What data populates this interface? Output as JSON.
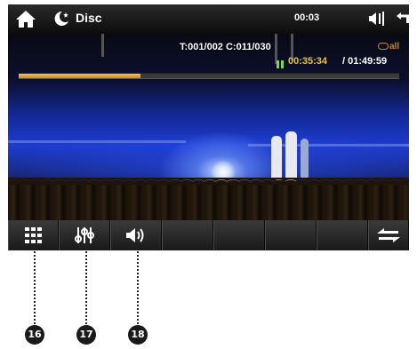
{
  "topbar": {
    "source_title": "Disc",
    "clock": "00:03"
  },
  "osd": {
    "track_chapter": "T:001/002 C:011/030",
    "repeat_mode": "all",
    "elapsed": "00:35:34",
    "total": "/ 01:49:59",
    "progress_fraction": 0.32
  },
  "controls": [
    {
      "name": "menu-grid-button",
      "icon": "grid-icon"
    },
    {
      "name": "equalizer-button",
      "icon": "equalizer-icon"
    },
    {
      "name": "volume-button",
      "icon": "speaker-icon"
    },
    {
      "name": "empty-slot-1",
      "icon": ""
    },
    {
      "name": "empty-slot-2",
      "icon": ""
    },
    {
      "name": "empty-slot-3",
      "icon": ""
    },
    {
      "name": "empty-slot-4",
      "icon": ""
    },
    {
      "name": "swap-button",
      "icon": "swap-arrows-icon"
    }
  ],
  "callouts": [
    "16",
    "17",
    "18"
  ],
  "colors": {
    "accent_progress": "#d89a2a",
    "elapsed_text": "#e6c23a",
    "repeat_text": "#c28a2a",
    "pause_indicator": "#7fd84a",
    "bar_bg": "#1a1a1a"
  }
}
